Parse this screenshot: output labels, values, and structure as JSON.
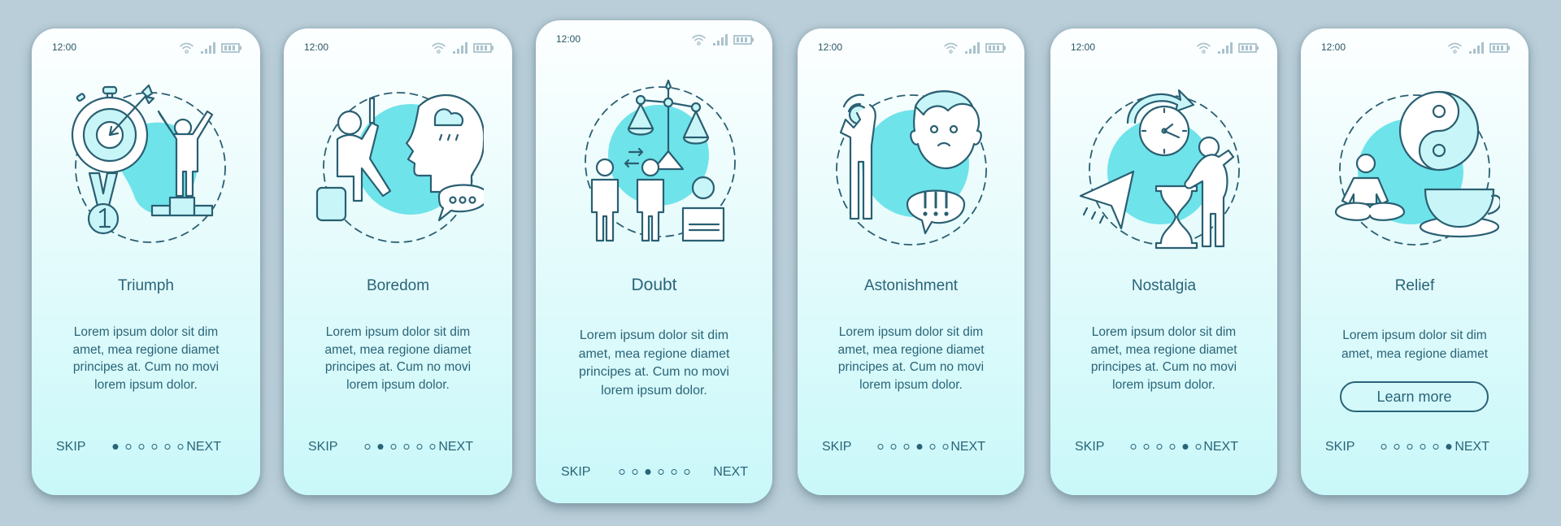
{
  "colors": {
    "background": "#b9ced8",
    "text": "#2a6478",
    "icon_stroke": "#2a5f72",
    "accent_blob": "#6fe3ea",
    "icon_fill_light": "#c8f6f8",
    "status_icons": "#aac2cc"
  },
  "screens": [
    {
      "status_time": "12:00",
      "illustration": "triumph-illustration",
      "title": "Triumph",
      "body": "Lorem ipsum dolor sit dim\namet, mea regione diamet\nprincipes at. Cum no movi\nlorem ipsum dolor.",
      "skip_label": "SKIP",
      "next_label": "NEXT",
      "active_page": 1,
      "page_count": 6
    },
    {
      "status_time": "12:00",
      "illustration": "boredom-illustration",
      "title": "Boredom",
      "body": "Lorem ipsum dolor sit dim\namet, mea regione diamet\nprincipes at. Cum no movi\nlorem ipsum dolor.",
      "skip_label": "SKIP",
      "next_label": "NEXT",
      "active_page": 2,
      "page_count": 6
    },
    {
      "status_time": "12:00",
      "illustration": "doubt-illustration",
      "title": "Doubt",
      "body": "Lorem ipsum dolor sit dim\namet, mea regione diamet\nprincipes at. Cum no movi\nlorem ipsum dolor.",
      "skip_label": "SKIP",
      "next_label": "NEXT",
      "active_page": 3,
      "page_count": 6
    },
    {
      "status_time": "12:00",
      "illustration": "astonishment-illustration",
      "title": "Astonishment",
      "body": "Lorem ipsum dolor sit dim\namet, mea regione diamet\nprincipes at. Cum no movi\nlorem ipsum dolor.",
      "skip_label": "SKIP",
      "next_label": "NEXT",
      "active_page": 4,
      "page_count": 6
    },
    {
      "status_time": "12:00",
      "illustration": "nostalgia-illustration",
      "title": "Nostalgia",
      "body": "Lorem ipsum dolor sit dim\namet, mea regione diamet\nprincipes at. Cum no movi\nlorem ipsum dolor.",
      "skip_label": "SKIP",
      "next_label": "NEXT",
      "active_page": 5,
      "page_count": 6
    },
    {
      "status_time": "12:00",
      "illustration": "relief-illustration",
      "title": "Relief",
      "body": "Lorem ipsum dolor sit dim\namet, mea regione diamet",
      "button_label": "Learn more",
      "skip_label": "SKIP",
      "next_label": "NEXT",
      "active_page": 6,
      "page_count": 6
    }
  ]
}
